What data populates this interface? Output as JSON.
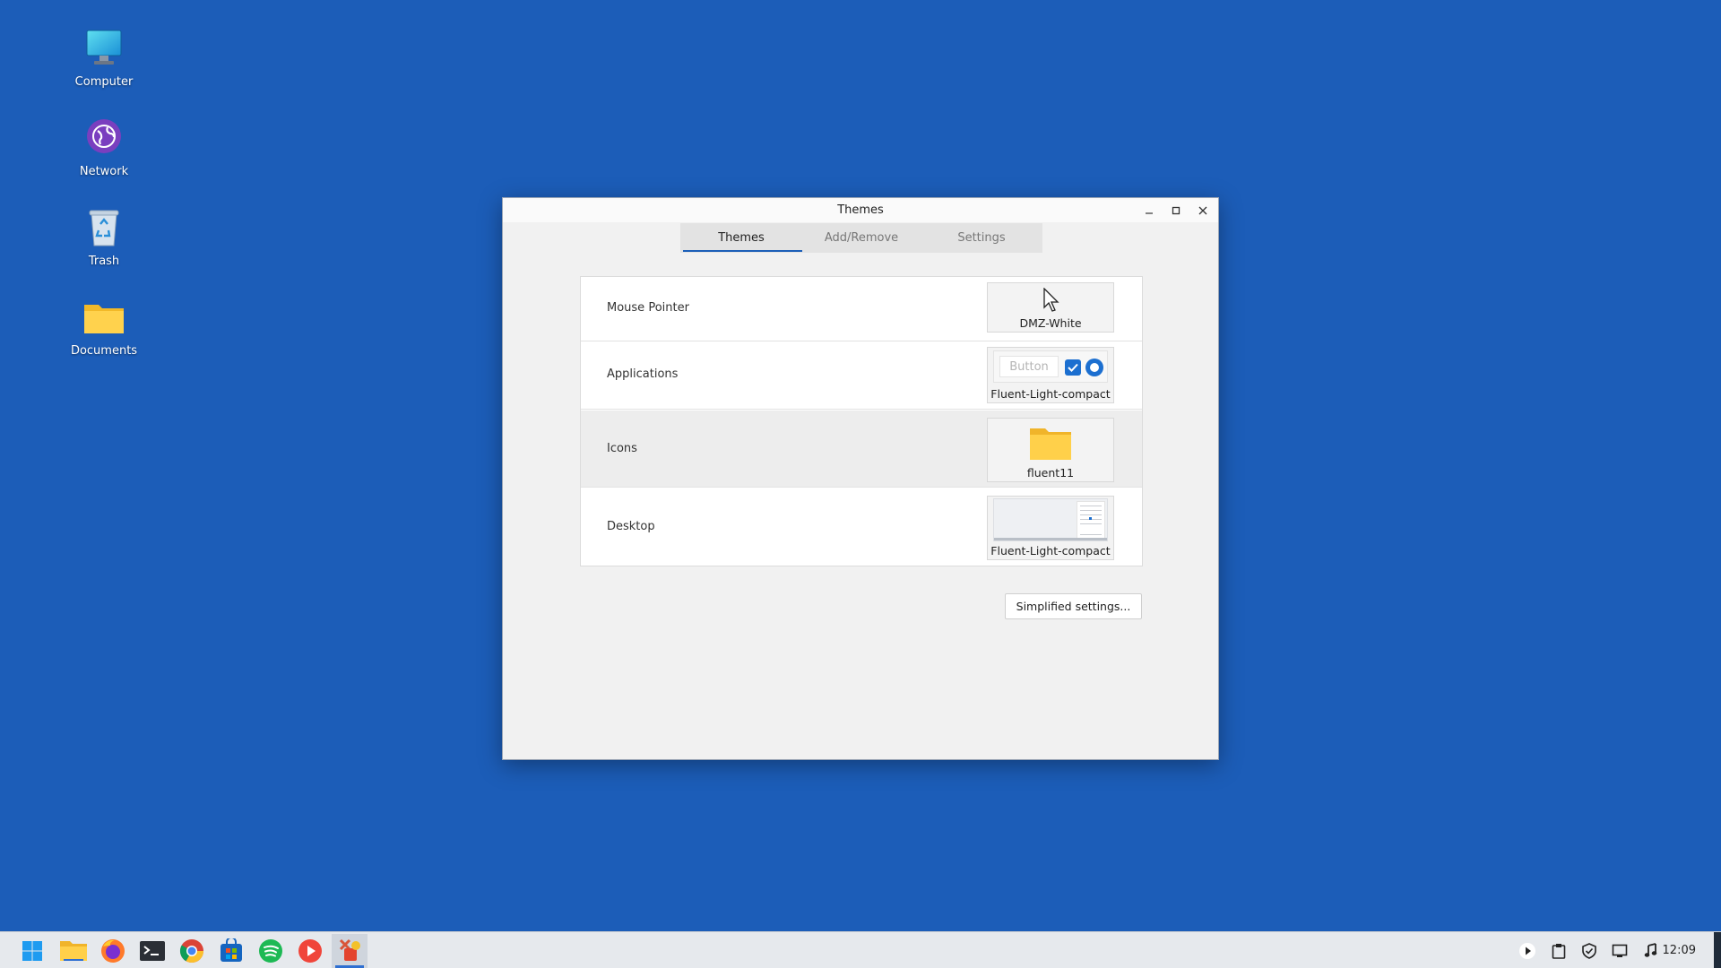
{
  "desktop": {
    "icons": [
      {
        "label": "Computer",
        "icon": "computer-icon"
      },
      {
        "label": "Network",
        "icon": "network-icon"
      },
      {
        "label": "Trash",
        "icon": "trash-icon"
      },
      {
        "label": "Documents",
        "icon": "folder-icon"
      }
    ]
  },
  "window": {
    "title": "Themes",
    "tabs": [
      {
        "label": "Themes",
        "active": true
      },
      {
        "label": "Add/Remove",
        "active": false
      },
      {
        "label": "Settings",
        "active": false
      }
    ],
    "rows": [
      {
        "label": "Mouse Pointer",
        "theme": "DMZ-White"
      },
      {
        "label": "Applications",
        "theme": "Fluent-Light-compact",
        "preview_button_text": "Button"
      },
      {
        "label": "Icons",
        "theme": "fluent11",
        "selected": true
      },
      {
        "label": "Desktop",
        "theme": "Fluent-Light-compact"
      }
    ],
    "simplified_button": "Simplified settings..."
  },
  "taskbar": {
    "apps": [
      "start-menu",
      "file-manager",
      "firefox",
      "terminal",
      "chrome",
      "app-store",
      "spotify",
      "media-player",
      "themes"
    ],
    "active_app": "themes",
    "tray": [
      "media-play-icon",
      "clipboard-icon",
      "shield-icon",
      "display-icon",
      "music-note-icon"
    ],
    "clock": "12:09"
  },
  "colors": {
    "desktop_bg": "#1c5db8",
    "accent": "#1c5fb8",
    "window_bg": "#f1f1f1"
  }
}
